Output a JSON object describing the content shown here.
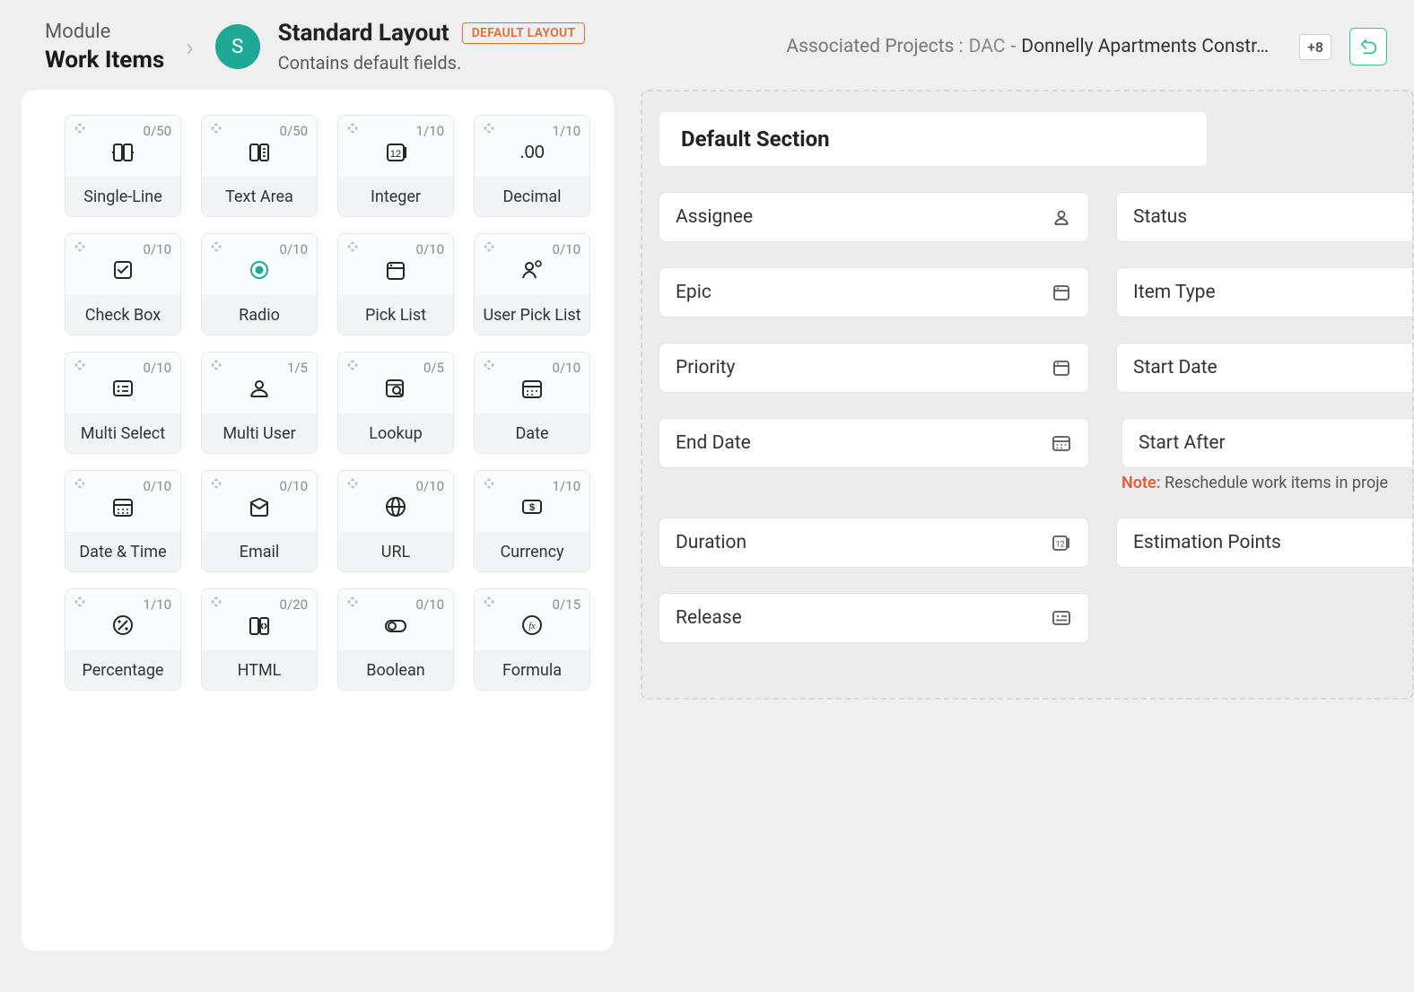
{
  "header": {
    "module_label": "Module",
    "module_name": "Work Items",
    "avatar_letter": "S",
    "layout_title": "Standard Layout",
    "tag": "DEFAULT LAYOUT",
    "layout_subtitle": "Contains default fields.",
    "assoc_label": "Associated Projects :",
    "project_code": "DAC",
    "project_dash": " - ",
    "project_name": "Donnelly Apartments Constr…",
    "plus_badge": "+8"
  },
  "palette": [
    {
      "name": "single-line",
      "label": "Single-Line",
      "count": "0/50",
      "icon": "single-line"
    },
    {
      "name": "text-area",
      "label": "Text Area",
      "count": "0/50",
      "icon": "text-area"
    },
    {
      "name": "integer",
      "label": "Integer",
      "count": "1/10",
      "icon": "integer"
    },
    {
      "name": "decimal",
      "label": "Decimal",
      "count": "1/10",
      "icon": "decimal"
    },
    {
      "name": "check-box",
      "label": "Check Box",
      "count": "0/10",
      "icon": "checkbox"
    },
    {
      "name": "radio",
      "label": "Radio",
      "count": "0/10",
      "icon": "radio"
    },
    {
      "name": "pick-list",
      "label": "Pick List",
      "count": "0/10",
      "icon": "picklist"
    },
    {
      "name": "user-pick-list",
      "label": "User Pick List",
      "count": "0/10",
      "icon": "userpick"
    },
    {
      "name": "multi-select",
      "label": "Multi Select",
      "count": "0/10",
      "icon": "multiselect"
    },
    {
      "name": "multi-user",
      "label": "Multi User",
      "count": "1/5",
      "icon": "multiuser"
    },
    {
      "name": "lookup",
      "label": "Lookup",
      "count": "0/5",
      "icon": "lookup"
    },
    {
      "name": "date",
      "label": "Date",
      "count": "0/10",
      "icon": "date"
    },
    {
      "name": "date-time",
      "label": "Date & Time",
      "count": "0/10",
      "icon": "datetime"
    },
    {
      "name": "email",
      "label": "Email",
      "count": "0/10",
      "icon": "email"
    },
    {
      "name": "url",
      "label": "URL",
      "count": "0/10",
      "icon": "url"
    },
    {
      "name": "currency",
      "label": "Currency",
      "count": "1/10",
      "icon": "currency"
    },
    {
      "name": "percentage",
      "label": "Percentage",
      "count": "1/10",
      "icon": "percent"
    },
    {
      "name": "html",
      "label": "HTML",
      "count": "0/20",
      "icon": "html"
    },
    {
      "name": "boolean",
      "label": "Boolean",
      "count": "0/10",
      "icon": "boolean"
    },
    {
      "name": "formula",
      "label": "Formula",
      "count": "0/15",
      "icon": "formula"
    }
  ],
  "canvas": {
    "section_title": "Default Section",
    "left_fields": [
      {
        "label": "Assignee",
        "icon": "user"
      },
      {
        "label": "Epic",
        "icon": "window"
      },
      {
        "label": "Priority",
        "icon": "window"
      },
      {
        "label": "End Date",
        "icon": "date-s"
      },
      {
        "label": "Duration",
        "icon": "int-s"
      },
      {
        "label": "Release",
        "icon": "card"
      }
    ],
    "right_fields": [
      {
        "label": "Status"
      },
      {
        "label": "Item Type"
      },
      {
        "label": "Start Date"
      },
      {
        "label": "Start After",
        "note_prefix": "Note:",
        "note": " Reschedule work items in proje"
      },
      {
        "label": "Estimation Points"
      }
    ]
  }
}
